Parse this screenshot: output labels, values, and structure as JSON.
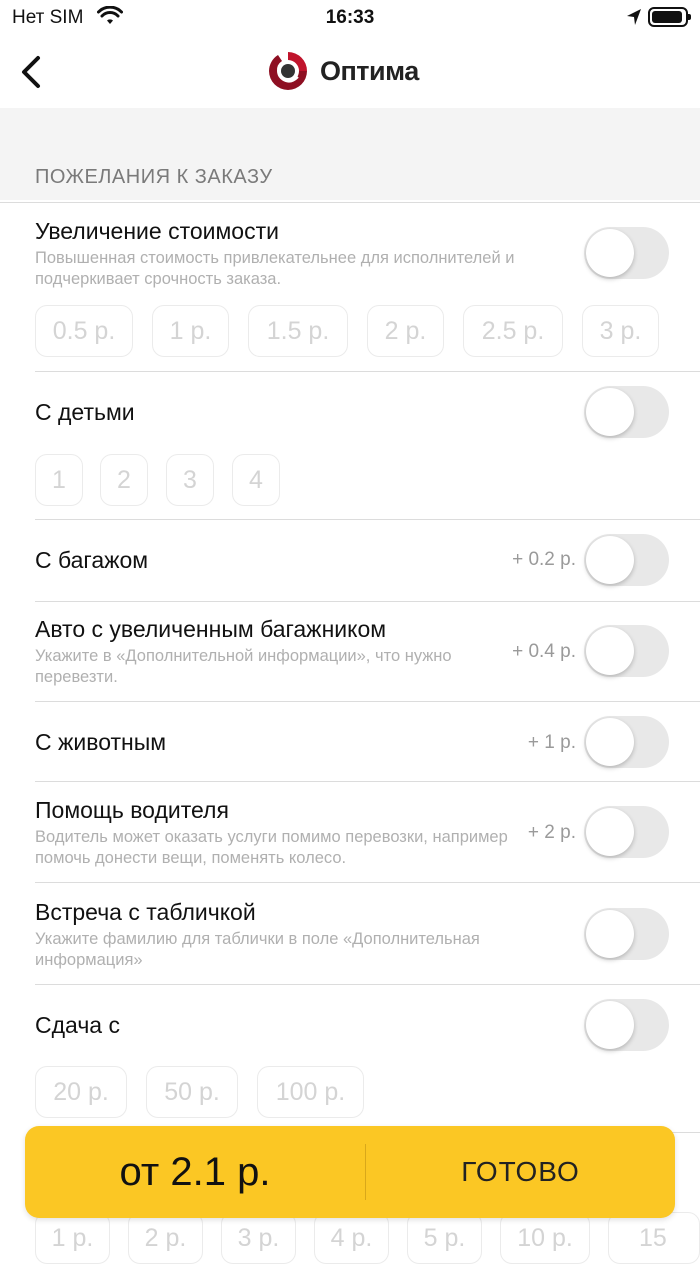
{
  "status": {
    "carrier": "Нет SIM",
    "time": "16:33"
  },
  "nav": {
    "brand": "Оптима"
  },
  "section_title": "ПОЖЕЛАНИЯ К ЗАКАЗУ",
  "rows": {
    "increase": {
      "title": "Увеличение стоимости",
      "subtitle": "Повышенная стоимость привлекательнее для исполнителей и подчеркивает срочность заказа."
    },
    "children": {
      "title": "С детьми"
    },
    "luggage": {
      "title": "С багажом",
      "price": "+ 0.2 р."
    },
    "big_trunk": {
      "title": "Авто с увеличенным багажником",
      "subtitle": "Укажите в «Дополнительной информации», что нужно перевезти.",
      "price": "+ 0.4 р."
    },
    "animal": {
      "title": "С животным",
      "price": "+ 1 р."
    },
    "driver_help": {
      "title": "Помощь водителя",
      "subtitle": "Водитель может оказать услуги помимо перевозки, например помочь донести вещи, поменять колесо.",
      "price": "+ 2 р."
    },
    "sign_meet": {
      "title": "Встреча с табличкой",
      "subtitle": "Укажите фамилию для таблички в поле «Дополнительная информация»"
    },
    "change": {
      "title": "Сдача с"
    }
  },
  "increase_chips": [
    "0.5 р.",
    "1 р.",
    "1.5 р.",
    "2 р.",
    "2.5 р.",
    "3 р."
  ],
  "children_chips": [
    "1",
    "2",
    "3",
    "4"
  ],
  "change_chips": [
    "20 р.",
    "50 р.",
    "100 р."
  ],
  "hidden_chips": [
    "1 р.",
    "2 р.",
    "3 р.",
    "4 р.",
    "5 р.",
    "10 р.",
    "15"
  ],
  "bottom": {
    "price": "от 2.1 р.",
    "done": "ГОТОВО"
  },
  "colors": {
    "accent": "#fbc724",
    "toggle_off": "#e8e8e8"
  }
}
